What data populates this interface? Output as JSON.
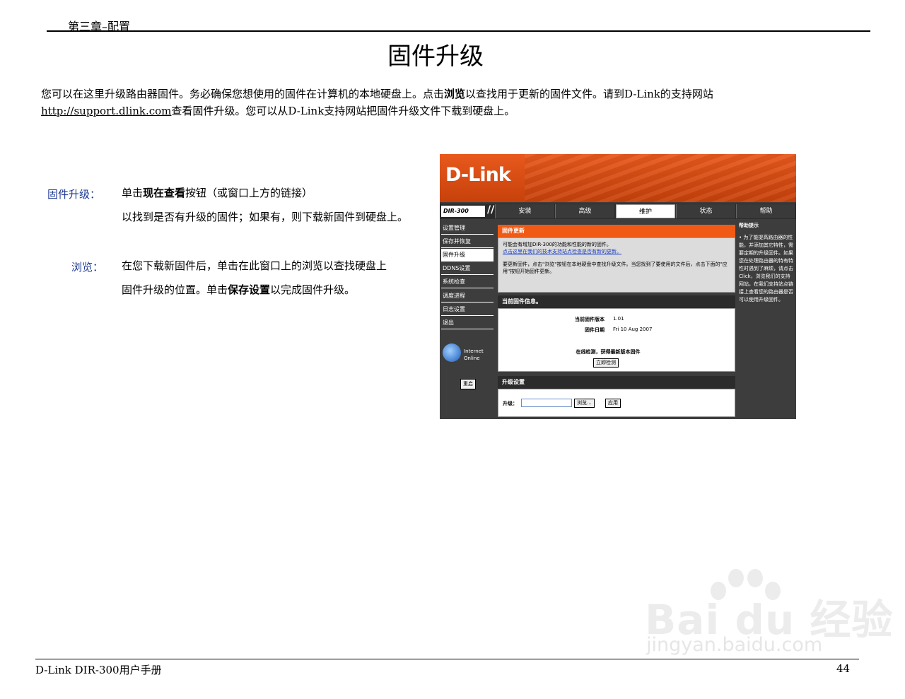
{
  "header": {
    "chapter": "第三章–配置"
  },
  "title": "固件升级",
  "intro": {
    "p1_a": "您可以在这里升级路由器固件。务必确保您想使用的固件在计算机的本地硬盘上。点击",
    "p1_b": "浏览",
    "p1_c": "以查找用于更新的固件文件。请到D-Link的支持网站",
    "link": "http://support.dlink.com",
    "p1_d": "查看固件升级。您可以从D-Link支持网站把固件升级文件下载到硬盘上。"
  },
  "sections": [
    {
      "term": "固件升级：",
      "line1_a": "单击",
      "line1_b": "现在查看",
      "line1_c": "按钮（或窗口上方的链接）",
      "line2": "以找到是否有升级的固件；如果有，则下载新固件到硬盘上。"
    },
    {
      "term": "浏览：",
      "line1": "在您下载新固件后，单击在此窗口上的浏览以查找硬盘上",
      "line2_a": "固件升级的位置。单击",
      "line2_b": "保存设置",
      "line2_c": "以完成固件升级。"
    }
  ],
  "screenshot": {
    "logo": "D-Link",
    "model": "DIR-300",
    "tabs": [
      "安装",
      "高级",
      "维护",
      "状态",
      "帮助"
    ],
    "active_tab": "维护",
    "sidebar": [
      "设置管理",
      "保存并恢复",
      "固件升级",
      "DDNS设置",
      "系统检查",
      "调度进程",
      "日志设置",
      "退出"
    ],
    "active_sidebar": "固件升级",
    "internet": "Internet Online",
    "back_button": "重启",
    "fw_update": {
      "title": "固件更新",
      "line1": "可能会有增加DIR-300的功能和性能的新的固件。",
      "link": "点击这里在我们的技术支持站点检查是否有新的更新。",
      "line2": "要更新固件，点击\"浏览\"按钮在本地硬盘中查找升级文件。当您找到了要使用的文件后，点击下面的\"应用\"按钮开始固件更新。"
    },
    "current_fw": {
      "title": "当前固件信息。",
      "version_label": "当前固件版本",
      "version": "1.01",
      "date_label": "固件日期",
      "date": "Fri 10 Aug 2007",
      "check_text": "在线检测，获得最新版本固件",
      "check_button": "立即检测"
    },
    "upgrade": {
      "title": "升级设置",
      "label": "升级：",
      "browse_button": "浏览...",
      "apply_button": "应用"
    },
    "help": {
      "title": "帮助提示",
      "text": "• 为了能提高路由器的性能，并添加其它特性，需要定期的升级固件。如果您在处理路由器的特有特性时遇到了麻烦，请点击Click，浏览我们的支持网站，在我们支持站点链接上查看您的路由器是否可以使用升级固件。"
    }
  },
  "footer": {
    "left": "D-Link DIR-300用户手册",
    "right": "44"
  },
  "watermark": {
    "main": "Bai du 经验",
    "sub": "jingyan.baidu.com"
  }
}
